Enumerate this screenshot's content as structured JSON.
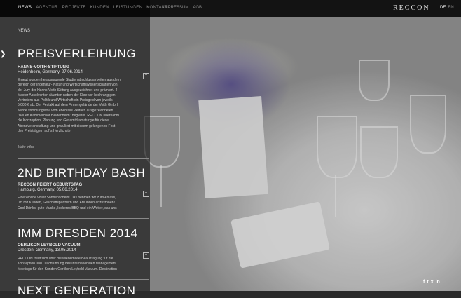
{
  "nav": {
    "items": [
      "NEWS",
      "AGENTUR",
      "PROJEKTE",
      "KUNDEN",
      "LEISTUNGEN",
      "KONTAKT"
    ],
    "secondary": [
      "IMPRESSUM",
      "AGB"
    ]
  },
  "brand": {
    "logo": "RECCON"
  },
  "language": {
    "active": "DE",
    "inactive": "EN"
  },
  "section_label": "NEWS",
  "news": [
    {
      "title": "PREISVERLEIHUNG",
      "subtitle": "HANNS-VOITH-STIFTUNG",
      "location_date": "Heidenheim, Germany, 27.06.2014",
      "body": "Erneut wurden herausragende Studienabschlussarbeiten aus dem Bereich der Ingenieur- Natur und Wirtschaftswissenschaften von der Jury der Hanns-Voith Stiftung ausgezeichnet und prämiert. 4 Master Absolventen räumten neben der Ehre vor hochrangigen Vertretern aus Politik und Wirtschaft ein Preisgeld von jeweils 5.000 € ab. Der Festakt auf dem Firmengelände der Voith GmbH wurde stimmungsvoll vom ebenfalls vielfach ausgezeichneten \"Neuen Kammerchor Heidenheim\" begleitet. RECCON übernahm die Konzeption, Planung und Gesamtdramaturgie für diese Abendveranstaltung und gratuliert mit diesem gelungenen Fest den Preisträgern auf´s Herzlichste!",
      "more": "Mehr Infos"
    },
    {
      "title": "2ND BIRTHDAY BASH",
      "subtitle": "RECCON FEIERT GEBURTSTAG",
      "location_date": "Hamburg, Germany, 05.06.2014",
      "body": "Eine Woche voller Sonnenschein! Das nehmen wir zum Anlass, um mit Kunden, Geschäftspartnern und Freunden anzustoßen! Cool Drinks, gute Mucke, leckeres BBQ und ein Wetter, das uns"
    },
    {
      "title": "IMM DRESDEN 2014",
      "subtitle": "OERLIKON LEYBOLD VACUUM",
      "location_date": "Dresden, Germany, 13.05.2014",
      "body": "RECCON freut sich über die wiederholte Beauftragung für die Konzeption und Durchführung des Internationalen Management Meetings für den Kunden Oerlikon Leybold Vacuum. Destination"
    },
    {
      "title": "NEXT GENERATION"
    }
  ],
  "social": {
    "facebook": "f",
    "twitter": "t",
    "xing": "x",
    "linkedin": "in"
  },
  "colors": {
    "overlay": "#000000",
    "text": "#ffffff",
    "muted": "#8a8a8a"
  }
}
